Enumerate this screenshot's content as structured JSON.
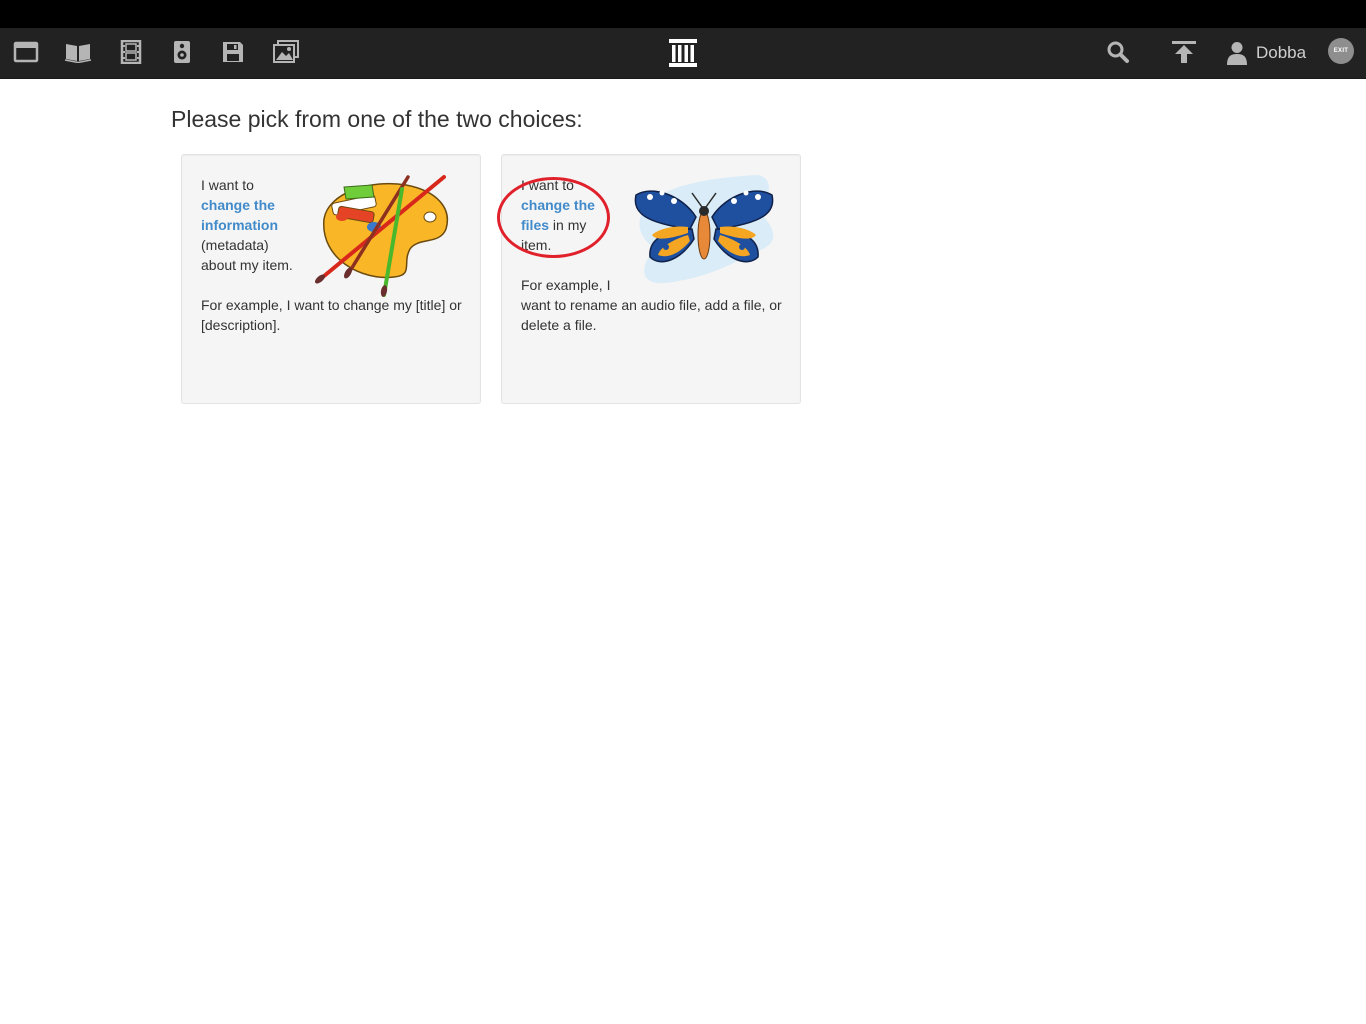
{
  "navbar": {
    "left_icons": [
      {
        "name": "web-icon"
      },
      {
        "name": "texts-icon"
      },
      {
        "name": "video-icon"
      },
      {
        "name": "audio-icon"
      },
      {
        "name": "software-icon"
      },
      {
        "name": "images-icon"
      }
    ],
    "logo": "archive-logo-icon",
    "right_icons": [
      "search-icon",
      "upload-icon"
    ],
    "user": {
      "name": "Dobba",
      "icon": "user-icon"
    },
    "exit_label": "EXIT"
  },
  "page": {
    "title": "Please pick from one of the two choices:"
  },
  "choices": [
    {
      "line1": "I want to",
      "link_line1": "change the",
      "link_line2": "information",
      "line2": "(metadata)",
      "line3": "about my item.",
      "example": "For example, I want to change my [title] or [description].",
      "art": "paint-palette-icon"
    },
    {
      "line1": "I want to",
      "link_line1": "change the",
      "link_line2": "files",
      "link_suffix": " in my",
      "line3": "item.",
      "example_line1": "For example, I",
      "example_rest": "want to rename an audio file, add a file, or delete a file.",
      "art": "butterfly-icon"
    }
  ],
  "colors": {
    "navbar_bg": "#222222",
    "link": "#428bca",
    "card_bg": "#f5f5f5",
    "annotation": "#e0202a"
  }
}
